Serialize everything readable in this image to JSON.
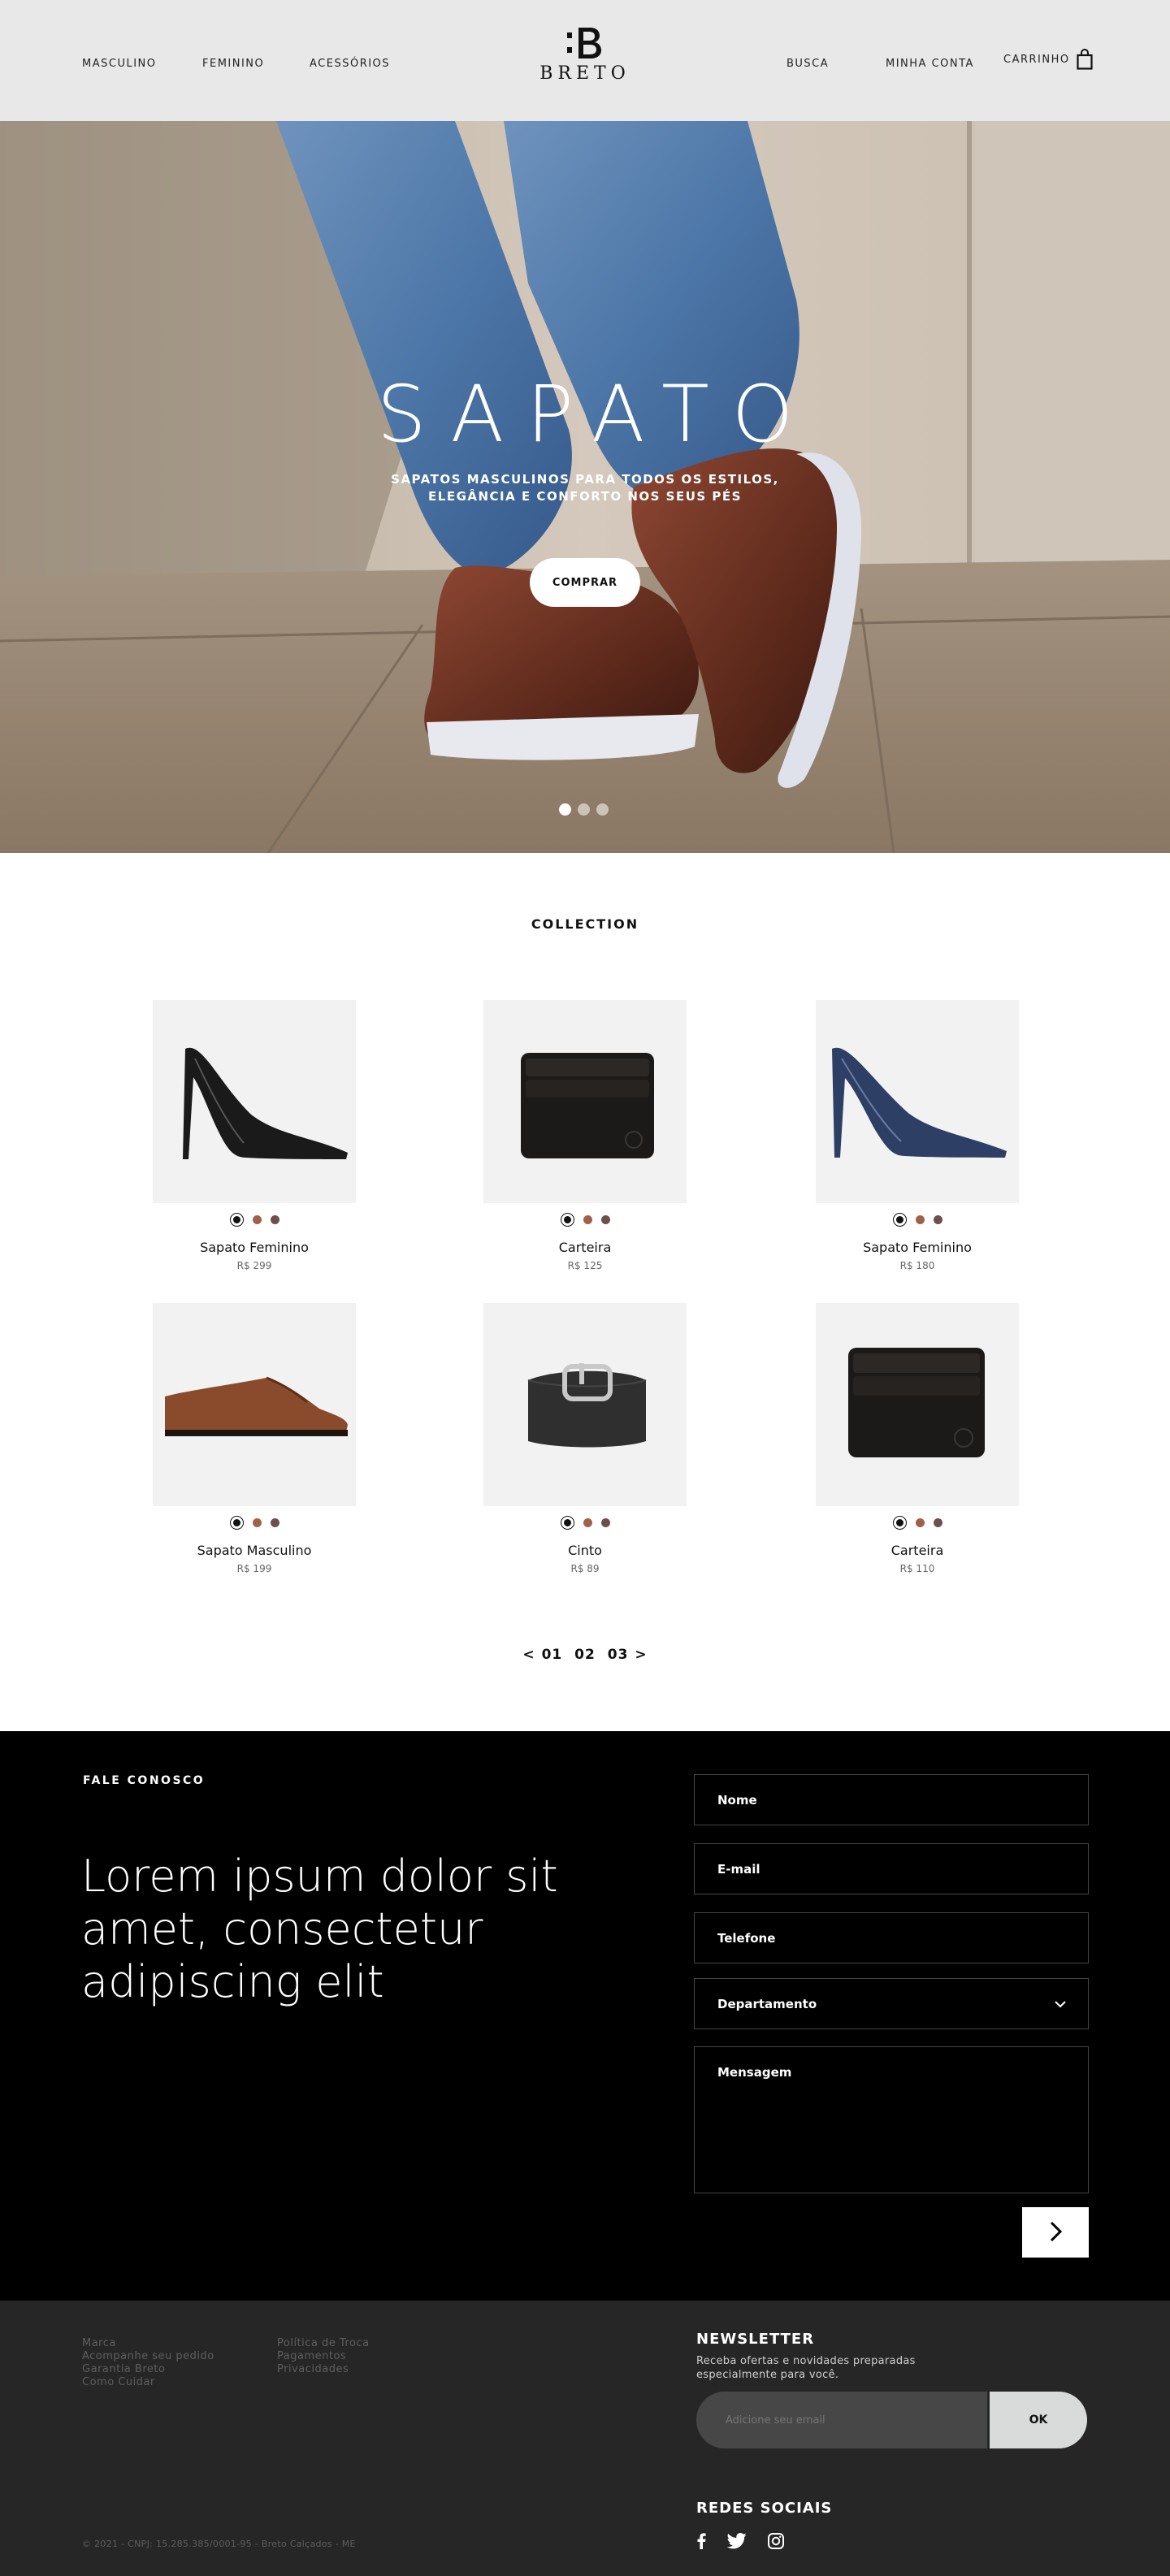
{
  "header": {
    "nav_left": [
      "MASCULINO",
      "FEMININO",
      "ACESSÓRIOS"
    ],
    "logo_text": "BRETO",
    "nav_right": [
      "BUSCA",
      "MINHA CONTA"
    ],
    "cart_label": "CARRINHO",
    "icons": {
      "cart": "shopping-bag-icon",
      "logo": "breto-logo-mark"
    }
  },
  "hero": {
    "title": "SAPATO",
    "subtitle_line1": "SAPATOS MASCULINOS PARA TODOS OS ESTILOS,",
    "subtitle_line2": "ELEGÂNCIA E CONFORTO NOS SEUS PÉS",
    "button_label": "COMPRAR",
    "slides": 3,
    "active_slide": 1
  },
  "collection": {
    "title": "COLLECTION",
    "swatch_colors": [
      "#111111",
      "#a0614a",
      "#6e4f4f"
    ],
    "products": [
      {
        "name": "Sapato Feminino",
        "price": "R$ 299",
        "image": "black-heel"
      },
      {
        "name": "Carteira",
        "price": "R$ 125",
        "image": "black-wallet"
      },
      {
        "name": "Sapato Feminino",
        "price": "R$ 180",
        "image": "navy-heel"
      },
      {
        "name": "Sapato Masculino",
        "price": "R$ 199",
        "image": "brown-oxford"
      },
      {
        "name": "Cinto",
        "price": "R$ 89",
        "image": "black-belt"
      },
      {
        "name": "Carteira",
        "price": "R$ 110",
        "image": "black-wallet"
      }
    ],
    "pagination": {
      "prev": "<",
      "pages": [
        "01",
        "02",
        "03"
      ],
      "next": ">"
    }
  },
  "contact": {
    "label": "FALE CONOSCO",
    "heading": "Lorem ipsum dolor sit amet, consectetur adipiscing elit",
    "fields": {
      "name": "Nome",
      "email": "E-mail",
      "phone": "Telefone",
      "department": "Departamento",
      "message": "Mensagem"
    },
    "send_icon": "chevron-right-icon"
  },
  "footer": {
    "links_col1": [
      "Marca",
      "Acompanhe seu pedido",
      "Garantia Breto",
      "Como Cuidar"
    ],
    "links_col2": [
      "Política de Troca",
      "Pagamentos",
      "Privacidades"
    ],
    "newsletter_title": "NEWSLETTER",
    "newsletter_desc": "Receba ofertas e novidades preparadas especialmente para você.",
    "newsletter_placeholder": "Adicione seu email",
    "newsletter_button": "OK",
    "social_title": "REDES SOCIAIS",
    "social_icons": [
      "facebook-icon",
      "twitter-icon",
      "instagram-icon"
    ],
    "copyright": "© 2021 - CNPJ: 15.285.385/0001-95 - Breto Calçados - ME"
  }
}
